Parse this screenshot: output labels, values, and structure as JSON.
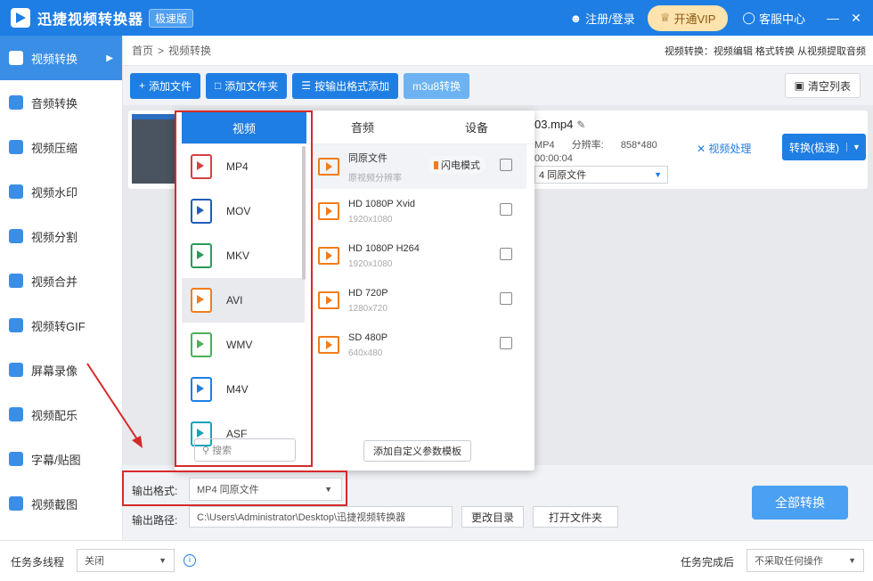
{
  "app": {
    "title": "迅捷视频转换器",
    "edition": "极速版",
    "login": "注册/登录",
    "vip": "开通VIP",
    "help": "客服中心"
  },
  "sidebar": {
    "items": [
      {
        "label": "视频转换",
        "icon": "video-convert-icon"
      },
      {
        "label": "音频转换",
        "icon": "audio-convert-icon"
      },
      {
        "label": "视频压缩",
        "icon": "video-compress-icon"
      },
      {
        "label": "视频水印",
        "icon": "watermark-icon"
      },
      {
        "label": "视频分割",
        "icon": "split-icon"
      },
      {
        "label": "视频合并",
        "icon": "merge-icon"
      },
      {
        "label": "视频转GIF",
        "icon": "gif-icon"
      },
      {
        "label": "屏幕录像",
        "icon": "screen-record-icon"
      },
      {
        "label": "视频配乐",
        "icon": "music-icon"
      },
      {
        "label": "字幕/贴图",
        "icon": "subtitle-icon"
      },
      {
        "label": "视频截图",
        "icon": "screenshot-icon"
      }
    ]
  },
  "breadcrumb": {
    "home": "首页",
    "current": "视频转换"
  },
  "tips": "视频转换：视频编辑 格式转换 从视频提取音频",
  "toolbar": {
    "add_file": "添加文件",
    "add_folder": "添加文件夹",
    "batch": "按输出格式添加",
    "m3u8": "m3u8转换",
    "clear": "清空列表"
  },
  "file": {
    "name": "03.mp4",
    "format": "MP4",
    "resolution_label": "分辨率:",
    "resolution": "858*480",
    "duration": "00:00:04",
    "out_format": "4  同原文件",
    "process": "视频处理",
    "convert": "转换(极速)"
  },
  "popup": {
    "tabs": {
      "video": "视频",
      "audio": "音频",
      "device": "设备"
    },
    "formats": [
      "MP4",
      "MOV",
      "MKV",
      "AVI",
      "WMV",
      "M4V",
      "ASF"
    ],
    "format_colors": [
      "#d34242",
      "#1e5fb6",
      "#2b9a5a",
      "#f07d1d",
      "#4cb05a",
      "#1e7ee4",
      "#17a2b8"
    ],
    "search_placeholder": "搜索",
    "presets": [
      {
        "title": "同原文件",
        "sub": "原视频分辨率"
      },
      {
        "title": "HD 1080P Xvid",
        "sub": "1920x1080"
      },
      {
        "title": "HD 1080P H264",
        "sub": "1920x1080"
      },
      {
        "title": "HD 720P",
        "sub": "1280x720"
      },
      {
        "title": "SD 480P",
        "sub": "640x480"
      }
    ],
    "flash": "闪电模式",
    "custom": "添加自定义参数模板"
  },
  "output": {
    "format_label": "输出格式:",
    "format_value": "MP4  同原文件",
    "path_label": "输出路径:",
    "path_value": "C:\\Users\\Administrator\\Desktop\\迅捷视频转换器",
    "change_dir": "更改目录",
    "open_folder": "打开文件夹",
    "convert_all": "全部转换"
  },
  "footer": {
    "multi_label": "任务多线程",
    "multi_value": "关闭",
    "done_label": "任务完成后",
    "done_value": "不采取任何操作"
  }
}
